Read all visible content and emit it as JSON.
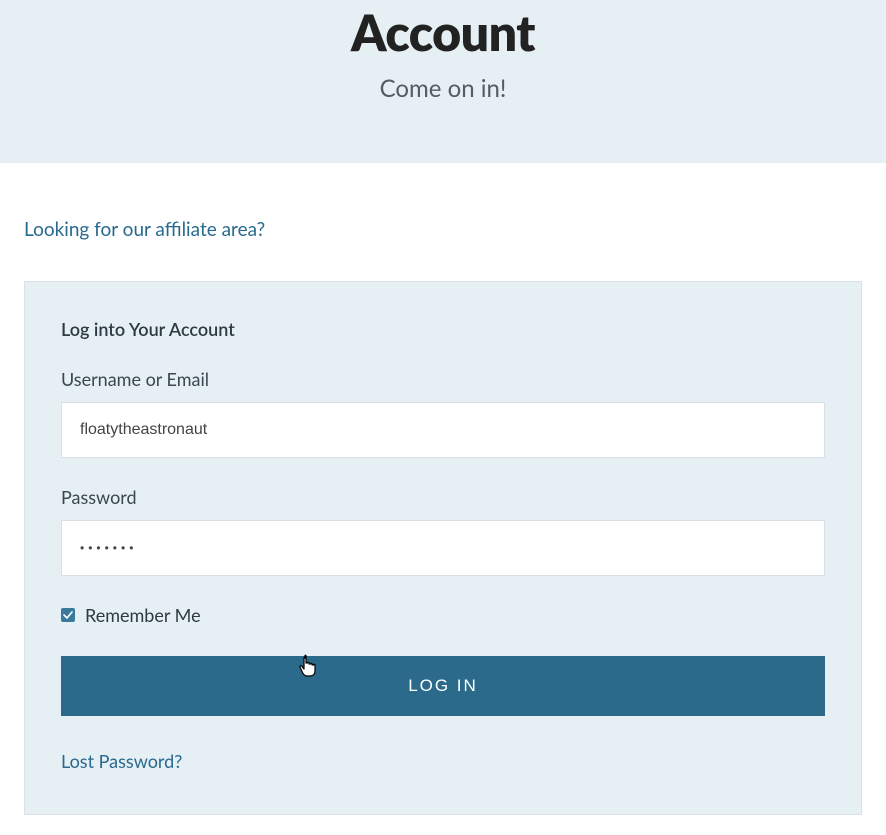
{
  "hero": {
    "title": "Account",
    "subtitle": "Come on in!"
  },
  "links": {
    "affiliate": "Looking for our affiliate area?",
    "lost_password": "Lost Password?"
  },
  "login_card": {
    "title": "Log into Your Account",
    "username_label": "Username or Email",
    "username_value": "floatytheastronaut",
    "password_label": "Password",
    "password_value": "•••••••",
    "remember_label": "Remember Me",
    "remember_checked": true,
    "submit_label": "LOG IN"
  }
}
